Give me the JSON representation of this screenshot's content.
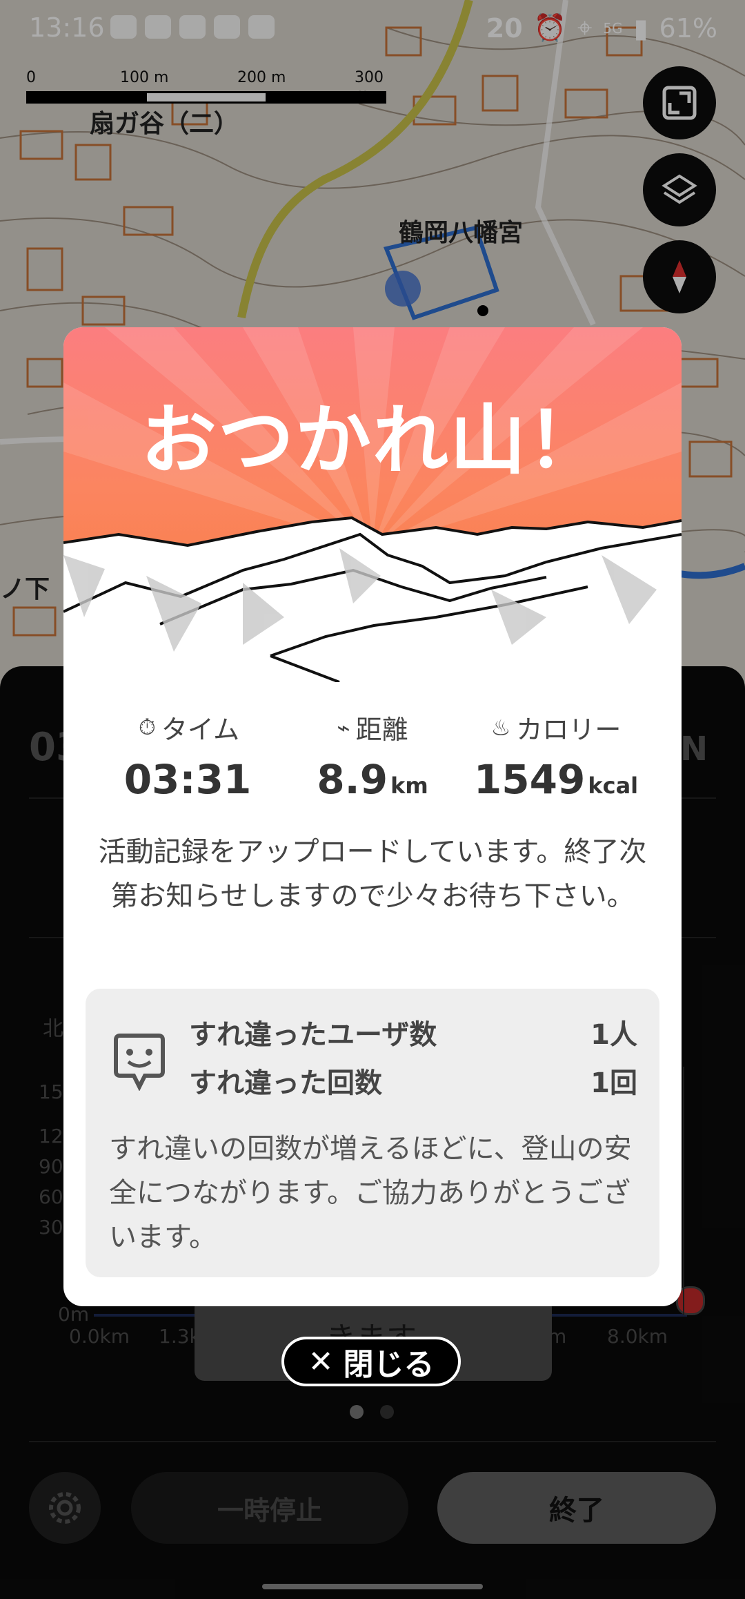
{
  "status_bar": {
    "time": "13:16",
    "temp": "20",
    "battery": "61%",
    "network": "5G"
  },
  "map": {
    "scale_ticks": [
      "0",
      "100 m",
      "200 m",
      "300 m"
    ],
    "place_labels": {
      "ogigayatsu": "扇ガ谷（二）",
      "hachimangu": "鶴岡八幡宮",
      "left_edge": "ノ下"
    }
  },
  "modal": {
    "title": "おつかれ山！",
    "stats": [
      {
        "label": "タイム",
        "value": "03:31",
        "unit": ""
      },
      {
        "label": "距離",
        "value": "8.9",
        "unit": "km"
      },
      {
        "label": "カロリー",
        "value": "1549",
        "unit": "kcal"
      }
    ],
    "upload_message": "活動記録をアップロードしています。終了次第お知らせしますので少々お待ち下さい。",
    "encounter": {
      "users_label": "すれ違ったユーザ数",
      "users_value": "1人",
      "count_label": "すれ違った回数",
      "count_value": "1回",
      "note": "すれ違いの回数が増えるほどに、登山の安全につながります。ご協力ありがとうございます。"
    },
    "close_label": "閉じる"
  },
  "panel": {
    "partial_time": "03",
    "partial_north": "N",
    "partial_axis_label": "北",
    "y_ticks": [
      "150",
      "120",
      "90",
      "60",
      "30",
      "0m"
    ],
    "x_ticks": [
      "0.0km",
      "1.3k",
      "m",
      "8.0km"
    ],
    "toast_text": "きます",
    "pause_label": "一時停止",
    "end_label": "終了"
  }
}
